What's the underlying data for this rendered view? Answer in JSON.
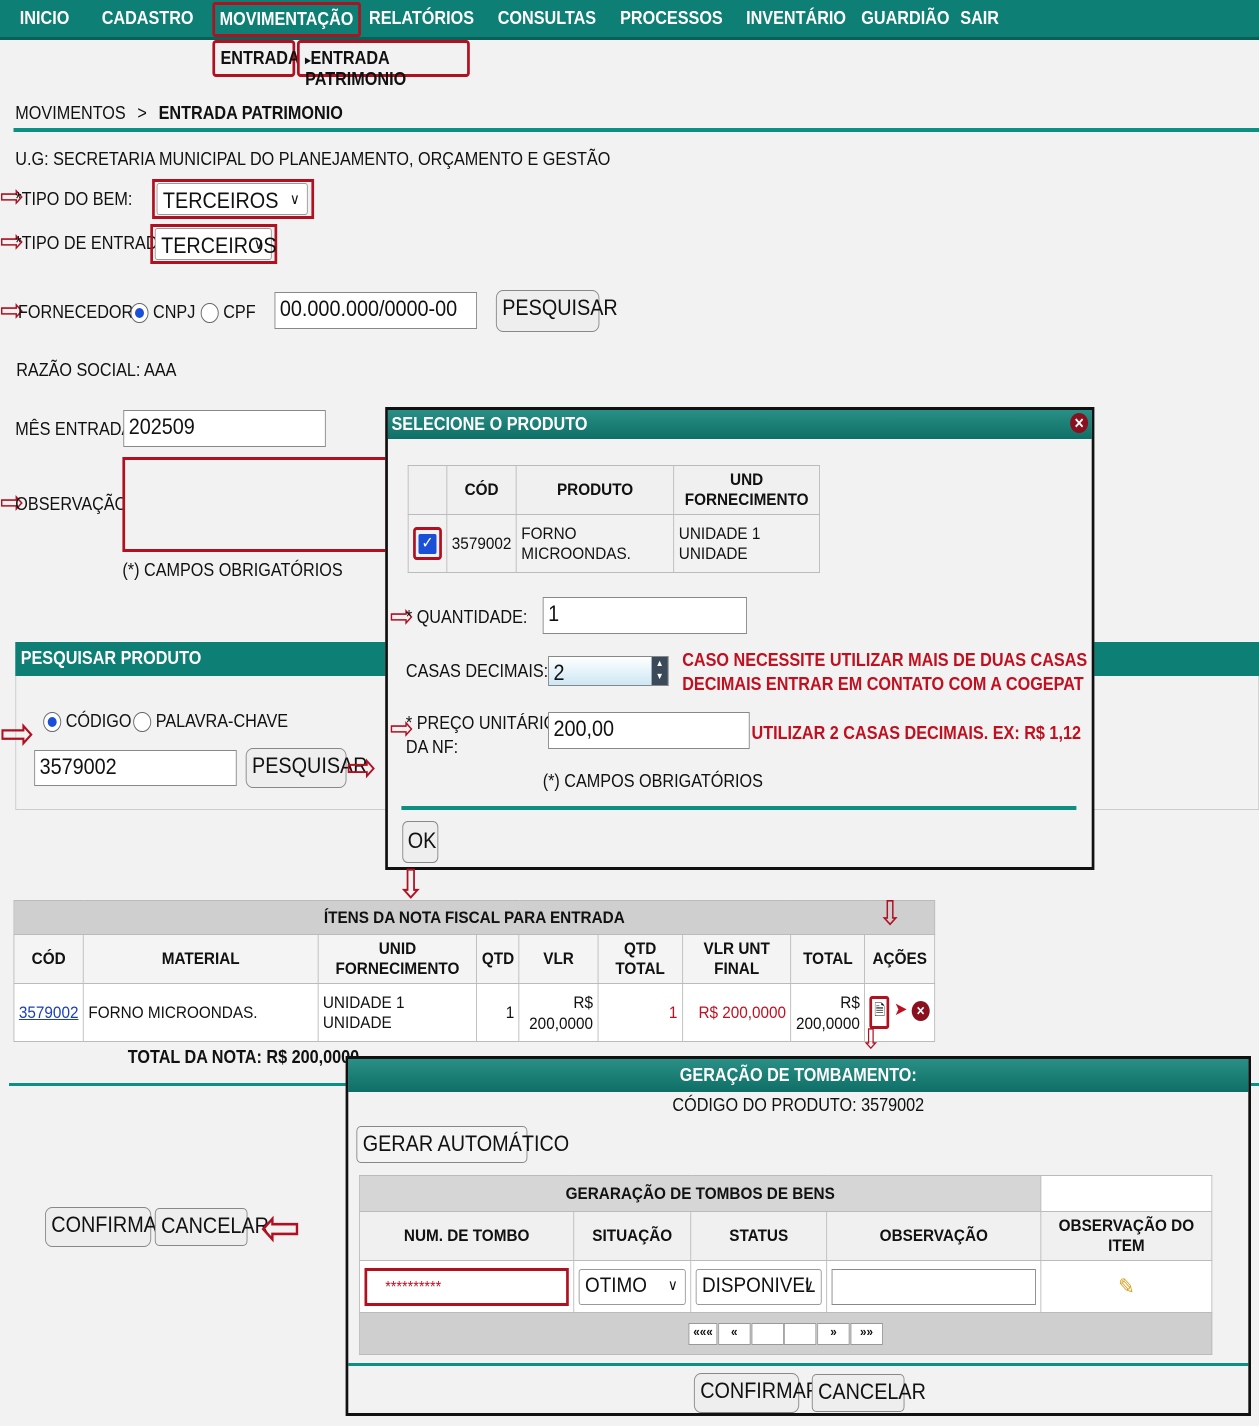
{
  "nav": {
    "items": [
      "INICIO",
      "CADASTRO",
      "MOVIMENTAÇÃO",
      "RELATÓRIOS",
      "CONSULTAS",
      "PROCESSOS",
      "INVENTÁRIO",
      "GUARDIÃO",
      "SAIR"
    ],
    "submenu": [
      "ENTRADA",
      "ENTRADA PATRIMONIO"
    ]
  },
  "breadcrumb": {
    "parent": "MOVIMENTOS",
    "separator": ">",
    "current": "ENTRADA PATRIMONIO"
  },
  "ug": "U.G: SECRETARIA MUNICIPAL DO PLANEJAMENTO, ORÇAMENTO E GESTÃO",
  "form": {
    "tipo_bem_label": "*TIPO DO BEM:",
    "tipo_bem_value": "TERCEIROS",
    "tipo_entrada_label": "*TIPO DE ENTRADA:",
    "tipo_entrada_value": "TERCEIROS",
    "fornecedor_label": "FORNECEDOR",
    "cnpj_label": "CNPJ",
    "cpf_label": "CPF",
    "fornecedor_value": "00.000.000/0000-00",
    "pesquisar_label": "PESQUISAR",
    "razao_social": "RAZÃO SOCIAL: AAA",
    "mes_entrada_label": "MÊS ENTRADA:",
    "mes_entrada_value": "202509",
    "observacao_label": "OBSERVAÇÃO:",
    "campos_obrigatorios": "(*) CAMPOS OBRIGATÓRIOS"
  },
  "pesquisar_produto": {
    "title": "PESQUISAR PRODUTO",
    "codigo_label": "CÓDIGO",
    "palavra_label": "PALAVRA-CHAVE",
    "input_value": "3579002",
    "button_label": "PESQUISAR"
  },
  "modal_produto": {
    "title": "SELECIONE O PRODUTO",
    "headers": [
      "",
      "CÓD",
      "PRODUTO",
      "UND FORNECIMENTO"
    ],
    "row": {
      "cod": "3579002",
      "produto": "FORNO MICROONDAS.",
      "und": "UNIDADE 1 UNIDADE"
    },
    "quantidade_label": "* QUANTIDADE:",
    "quantidade_value": "1",
    "casas_label": "CASAS DECIMAIS:",
    "casas_value": "2",
    "casas_hint_1": "CASO NECESSITE UTILIZAR MAIS DE DUAS CASAS",
    "casas_hint_2": "DECIMAIS ENTRAR EM CONTATO COM A COGEPAT",
    "preco_label_1": "* PREÇO UNITÁRIO",
    "preco_label_2": "DA NF:",
    "preco_value": "200,00",
    "preco_hint": "UTILIZAR 2 CASAS DECIMAIS. EX: R$ 1,12",
    "campos_obrigatorios": "(*) CAMPOS OBRIGATÓRIOS",
    "ok_label": "OK"
  },
  "itens": {
    "title": "ÍTENS DA NOTA FISCAL PARA ENTRADA",
    "headers": [
      "CÓD",
      "MATERIAL",
      "UNID FORNECIMENTO",
      "QTD",
      "VLR",
      "QTD TOTAL",
      "VLR UNT FINAL",
      "TOTAL",
      "AÇÕES"
    ],
    "row": {
      "cod": "3579002",
      "material": "FORNO MICROONDAS.",
      "unid": "UNIDADE 1 UNIDADE",
      "qtd": "1",
      "vlr_1": "R$",
      "vlr_2": "200,0000",
      "qtd_total": "1",
      "vlr_unt_final": "R$ 200,0000",
      "total_1": "R$",
      "total_2": "200,0000"
    },
    "total_nota": "TOTAL DA NOTA: R$ 200,0000",
    "action_icons": [
      "document-icon",
      "pin-icon",
      "delete-icon"
    ]
  },
  "main_actions": {
    "confirmar": "CONFIRMAR",
    "cancelar": "CANCELAR"
  },
  "tombamento": {
    "title": "GERAÇÃO DE TOMBAMENTO:",
    "codigo_produto": "CÓDIGO DO PRODUTO: 3579002",
    "gerar_label": "GERAR AUTOMÁTICO",
    "grid_title": "GERARAÇÃO DE TOMBOS DE BENS",
    "headers": [
      "NUM. DE TOMBO",
      "SITUAÇÃO",
      "STATUS",
      "OBSERVAÇÃO",
      "OBSERVAÇÃO DO ITEM"
    ],
    "tombo_value": "**********",
    "situacao_value": "OTIMO",
    "status_value": "DISPONIVEL",
    "pager": [
      "«««",
      "«",
      "",
      "",
      "»",
      "»»"
    ],
    "confirmar": "CONFIRMAR",
    "cancelar": "CANCELAR"
  },
  "colors": {
    "teal": "#0e7f74",
    "annotation_red": "#b01020",
    "hint_red": "#c01020"
  }
}
